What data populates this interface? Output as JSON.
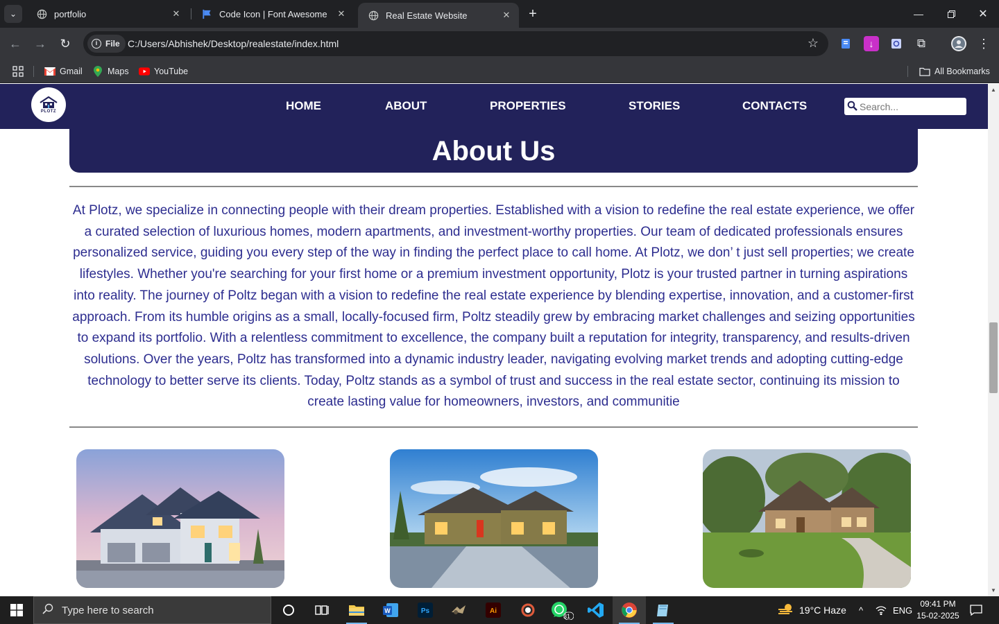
{
  "browser": {
    "tabs": [
      {
        "title": "portfolio",
        "icon": "globe-icon",
        "active": false
      },
      {
        "title": "Code Icon | Font Awesome",
        "icon": "flag-icon",
        "active": false
      },
      {
        "title": "Real Estate Website",
        "icon": "globe-icon",
        "active": true
      }
    ],
    "chip_label": "File",
    "url": "C:/Users/Abhishek/Desktop/realestate/index.html",
    "bookmarks": [
      {
        "label": "Gmail",
        "icon": "gmail-icon"
      },
      {
        "label": "Maps",
        "icon": "maps-icon"
      },
      {
        "label": "YouTube",
        "icon": "youtube-icon"
      }
    ],
    "all_bookmarks_label": "All Bookmarks"
  },
  "site": {
    "logo_text": "PLOTZ",
    "nav": [
      "HOME",
      "ABOUT",
      "PROPERTIES",
      "STORIES",
      "CONTACTS"
    ],
    "search_placeholder": "Search...",
    "about_title": "About Us",
    "about_text": "At Plotz, we specialize in connecting people with their dream properties. Established with a vision to redefine the real estate experience, we offer a curated selection of luxurious homes, modern apartments, and investment-worthy properties. Our team of dedicated professionals ensures personalized service, guiding you every step of the way in finding the perfect place to call home. At Plotz, we don’ t just sell properties; we create lifestyles. Whether you're searching for your first home or a premium investment opportunity, Plotz is your trusted partner in turning aspirations into reality. The journey of Poltz began with a vision to redefine the real estate experience by blending expertise, innovation, and a customer-first approach. From its humble origins as a small, locally-focused firm, Poltz steadily grew by embracing market challenges and seizing opportunities to expand its portfolio. With a relentless commitment to excellence, the company built a reputation for integrity, transparency, and results-driven solutions. Over the years, Poltz has transformed into a dynamic industry leader, navigating evolving market trends and adopting cutting-edge technology to better serve its clients. Today, Poltz stands as a symbol of trust and success in the real estate sector, continuing its mission to create lasting value for homeowners, investors, and communitie",
    "colors": {
      "nav_bg": "#22225a",
      "text": "#2d2d8f"
    }
  },
  "taskbar": {
    "search_placeholder": "Type here to search",
    "whatsapp_badge": "31",
    "weather": "19°C  Haze",
    "lang": "ENG",
    "time": "09:41 PM",
    "date": "15-02-2025"
  }
}
